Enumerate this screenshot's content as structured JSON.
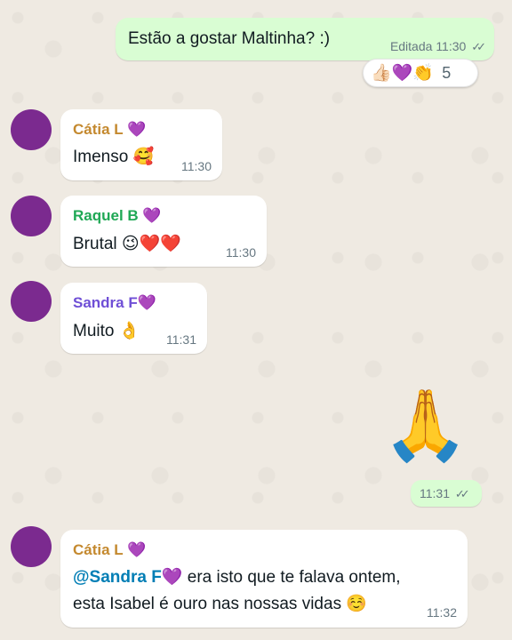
{
  "messages": {
    "m1": {
      "text": "Estão a gostar Maltinha? :)",
      "edited": "Editada",
      "time": "11:30",
      "ticks": "✓✓",
      "reactions": {
        "emojis": "👍🏻💜👏",
        "count": "5"
      }
    },
    "m2": {
      "sender": "Cátia L 💜",
      "sender_color": "#c4892f",
      "text": "Imenso 🥰",
      "time": "11:30"
    },
    "m3": {
      "sender": "Raquel B 💜",
      "sender_color": "#1fa855",
      "text": "Brutal 😉❤️❤️",
      "time": "11:30"
    },
    "m4": {
      "sender": "Sandra F💜",
      "sender_color": "#6f4fd6",
      "text": "Muito 👌",
      "time": "11:31"
    },
    "m5": {
      "emoji": "🙏",
      "time": "11:31",
      "ticks": "✓✓"
    },
    "m6": {
      "sender": "Cátia L 💜",
      "sender_color": "#c4892f",
      "mention": "@Sandra F💜",
      "text_line1": " era isto que te falava ontem,",
      "text_line2": "esta Isabel é ouro nas nossas vidas ☺️",
      "time": "11:32"
    }
  },
  "colors": {
    "outgoing": "#d9fdd3",
    "incoming": "#ffffff",
    "avatar": "#7b2a8f",
    "mention": "#027eb5"
  }
}
